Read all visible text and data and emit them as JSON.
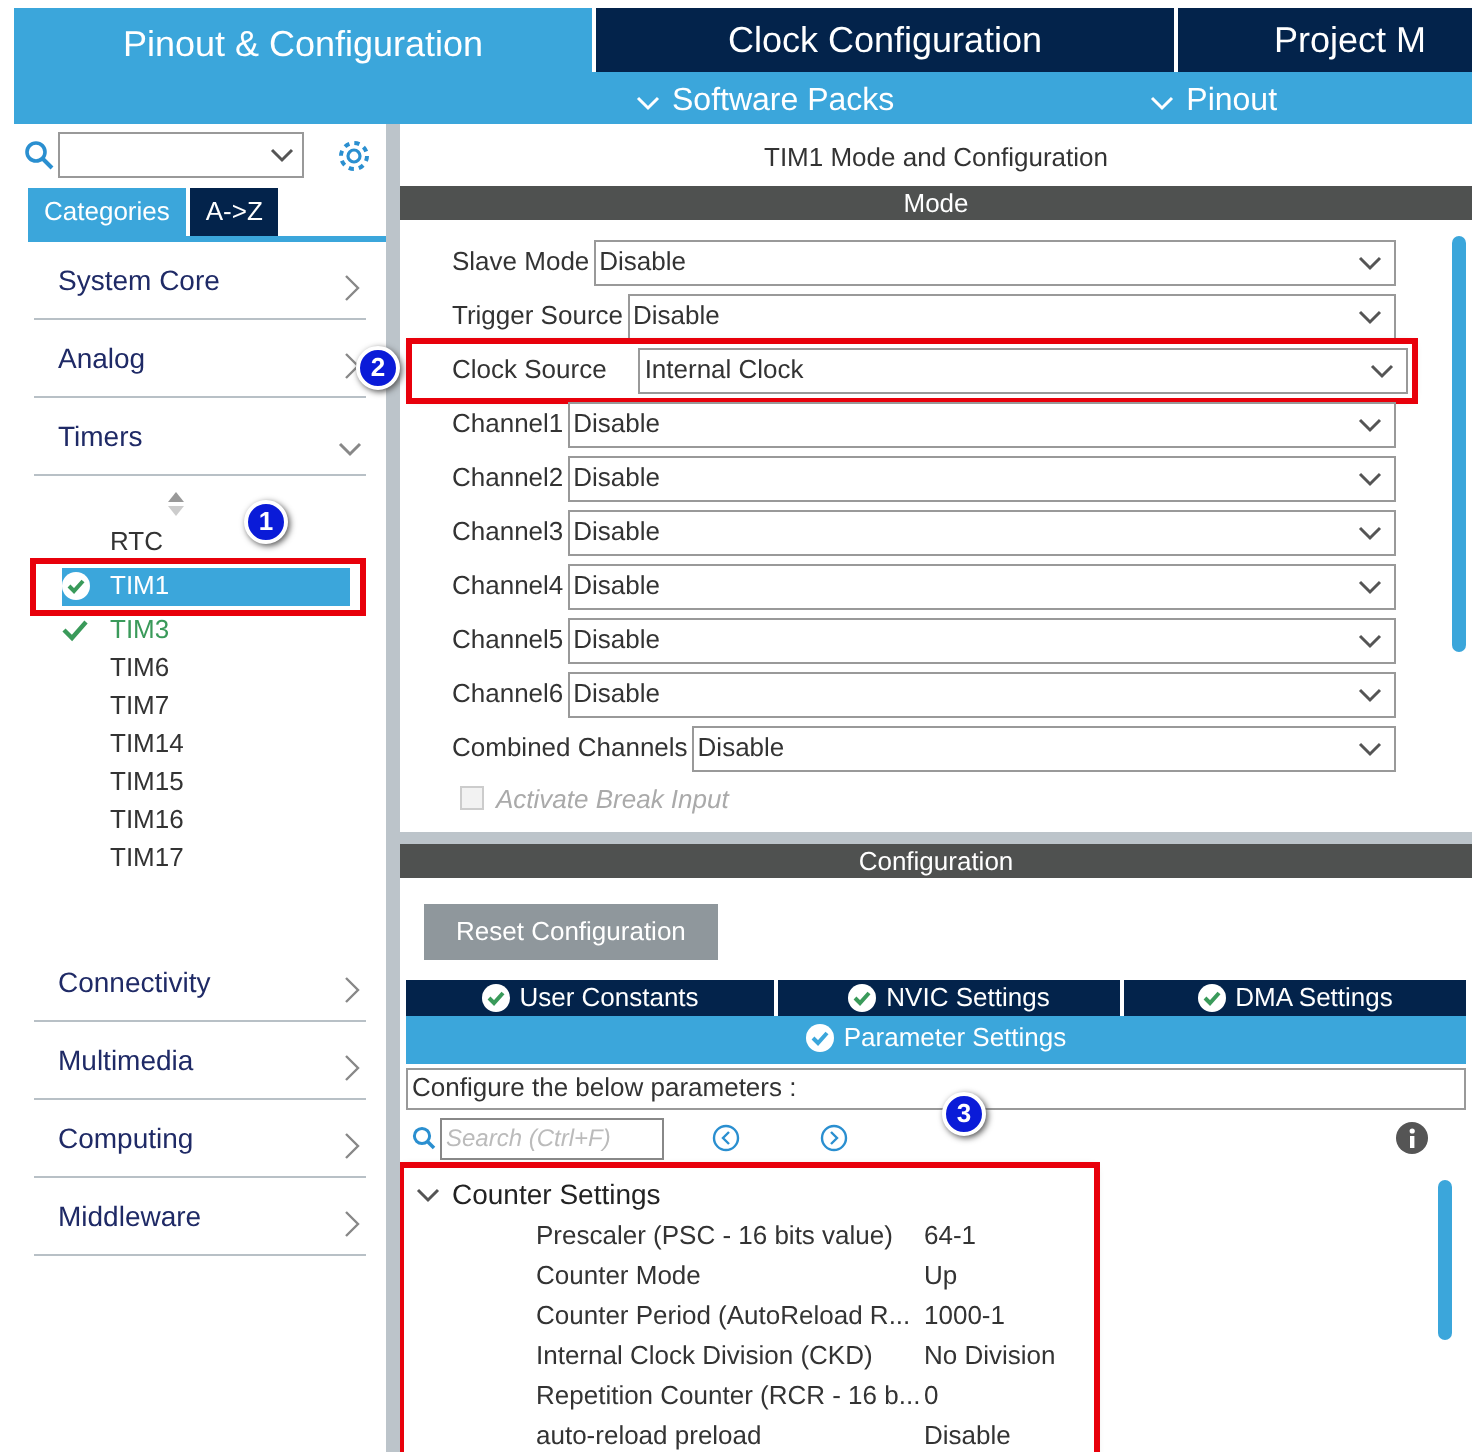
{
  "top_tabs": [
    {
      "label": "Pinout & Configuration",
      "selected": true
    },
    {
      "label": "Clock Configuration",
      "selected": false
    },
    {
      "label": "Project M",
      "selected": false
    }
  ],
  "sub_menus": [
    {
      "label": "Software Packs"
    },
    {
      "label": "Pinout"
    }
  ],
  "sidebar": {
    "view_tabs": [
      {
        "label": "Categories",
        "selected": true
      },
      {
        "label": "A->Z",
        "selected": false
      }
    ],
    "categories": [
      {
        "label": "System Core",
        "expanded": false
      },
      {
        "label": "Analog",
        "expanded": false
      },
      {
        "label": "Timers",
        "expanded": true,
        "children": [
          {
            "label": "RTC",
            "selected": false,
            "checked": false
          },
          {
            "label": "TIM1",
            "selected": true,
            "checked": true,
            "highlighted": true,
            "marker": "1"
          },
          {
            "label": "TIM3",
            "selected": false,
            "checked": true
          },
          {
            "label": "TIM6",
            "selected": false,
            "checked": false
          },
          {
            "label": "TIM7",
            "selected": false,
            "checked": false
          },
          {
            "label": "TIM14",
            "selected": false,
            "checked": false
          },
          {
            "label": "TIM15",
            "selected": false,
            "checked": false
          },
          {
            "label": "TIM16",
            "selected": false,
            "checked": false
          },
          {
            "label": "TIM17",
            "selected": false,
            "checked": false
          }
        ]
      },
      {
        "label": "Connectivity",
        "expanded": false
      },
      {
        "label": "Multimedia",
        "expanded": false
      },
      {
        "label": "Computing",
        "expanded": false
      },
      {
        "label": "Middleware",
        "expanded": false
      }
    ]
  },
  "mode_panel": {
    "title": "TIM1 Mode and Configuration",
    "header": "Mode",
    "fields": [
      {
        "label": "Slave Mode",
        "value": "Disable"
      },
      {
        "label": "Trigger Source",
        "value": "Disable"
      },
      {
        "label": "Clock Source",
        "value": "Internal Clock",
        "highlighted": true,
        "marker": "2"
      },
      {
        "label": "Channel1",
        "value": "Disable"
      },
      {
        "label": "Channel2",
        "value": "Disable"
      },
      {
        "label": "Channel3",
        "value": "Disable"
      },
      {
        "label": "Channel4",
        "value": "Disable"
      },
      {
        "label": "Channel5",
        "value": "Disable"
      },
      {
        "label": "Channel6",
        "value": "Disable"
      },
      {
        "label": "Combined Channels",
        "value": "Disable"
      }
    ],
    "checkbox": {
      "label": "Activate Break Input",
      "checked": false,
      "disabled": true
    }
  },
  "config_panel": {
    "header": "Configuration",
    "reset_button": "Reset Configuration",
    "tabs": [
      {
        "label": "User Constants",
        "selected": false
      },
      {
        "label": "NVIC Settings",
        "selected": false
      },
      {
        "label": "DMA Settings",
        "selected": false
      },
      {
        "label": "Parameter Settings",
        "selected": true
      }
    ],
    "hint": "Configure the below parameters :",
    "marker": "3",
    "search": {
      "placeholder": "Search (Ctrl+F)"
    },
    "groups": [
      {
        "label": "Counter Settings",
        "expanded": true,
        "highlighted": true,
        "children": [
          {
            "name": "Prescaler (PSC - 16 bits value)",
            "value": "64-1"
          },
          {
            "name": "Counter Mode",
            "value": "Up"
          },
          {
            "name": "Counter Period (AutoReload R...",
            "value": "1000-1"
          },
          {
            "name": "Internal Clock Division (CKD)",
            "value": "No Division"
          },
          {
            "name": "Repetition Counter (RCR - 16 b...",
            "value": "0"
          },
          {
            "name": "auto-reload preload",
            "value": "Disable"
          }
        ]
      }
    ]
  }
}
